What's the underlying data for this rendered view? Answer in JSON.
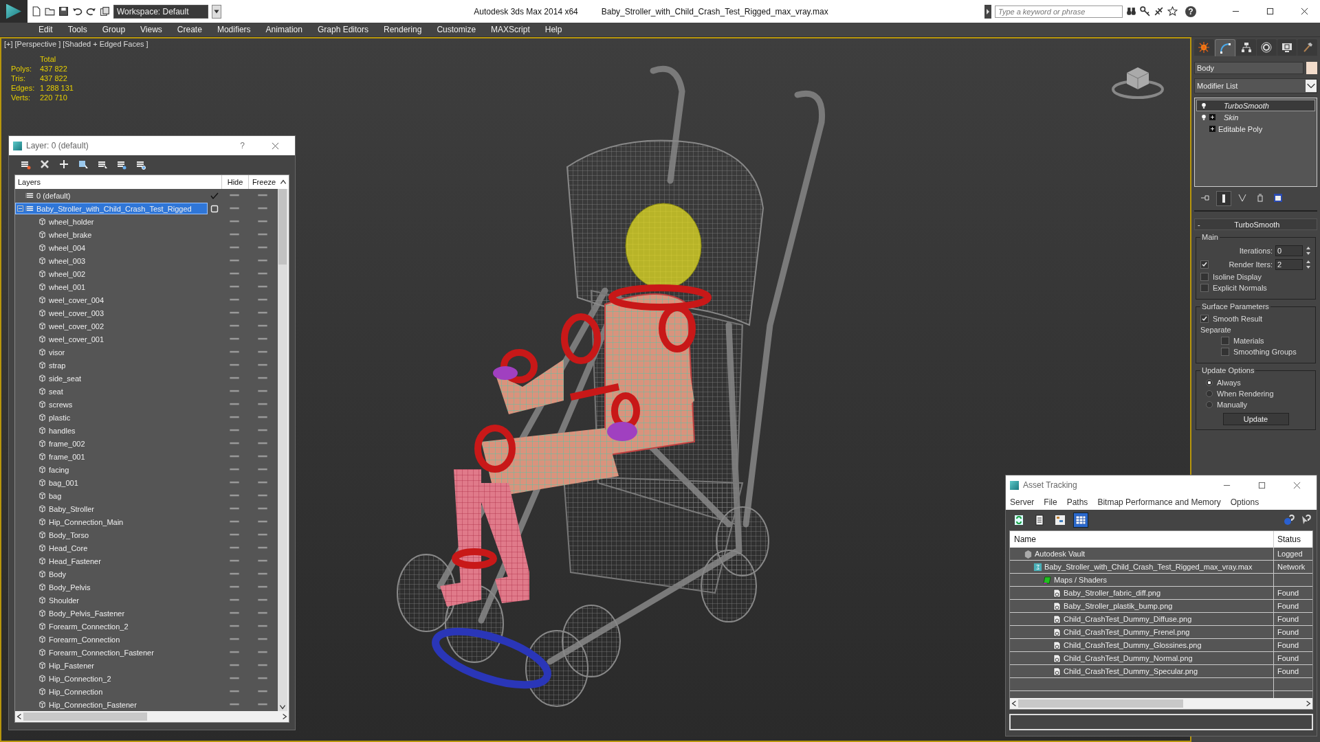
{
  "title_bar": {
    "workspace": "Workspace: Default",
    "app_title": "Autodesk 3ds Max  2014 x64",
    "file_name": "Baby_Stroller_with_Child_Crash_Test_Rigged_max_vray.max",
    "search": {
      "placeholder": "Type a keyword or phrase"
    },
    "help": "?"
  },
  "menu": [
    "Edit",
    "Tools",
    "Group",
    "Views",
    "Create",
    "Modifiers",
    "Animation",
    "Graph Editors",
    "Rendering",
    "Customize",
    "MAXScript",
    "Help"
  ],
  "viewport": {
    "labels": [
      "[+]",
      "[Perspective ]",
      "[Shaded + Edged Faces ]"
    ],
    "active": true,
    "stats": {
      "header": "Total",
      "rows": [
        {
          "label": "Polys:",
          "value": "437 822"
        },
        {
          "label": "Tris:",
          "value": "437 822"
        },
        {
          "label": "Edges:",
          "value": "1 288 131"
        },
        {
          "label": "Verts:",
          "value": "220 710"
        }
      ]
    }
  },
  "layer_dialog": {
    "title": "Layer: 0 (default)",
    "help": "?",
    "columns": [
      "Layers",
      "Hide",
      "Freeze"
    ],
    "tools": [
      {
        "kind": "new_layer"
      },
      {
        "kind": "delete"
      },
      {
        "kind": "add"
      },
      {
        "kind": "select_objects"
      },
      {
        "kind": "select_layer"
      },
      {
        "kind": "highlight"
      },
      {
        "kind": "settings"
      }
    ],
    "layers": [
      {
        "name": "0 (default)",
        "kind": "layer",
        "current": true,
        "selected": false,
        "hidden": false,
        "frozen": false
      },
      {
        "name": "Baby_Stroller_with_Child_Crash_Test_Rigged",
        "kind": "layer",
        "current": false,
        "selected": true,
        "expanded": true,
        "hidden": false,
        "frozen": false,
        "children": [
          {
            "name": "wheel_holder",
            "kind": "object",
            "selected": false,
            "hidden": false,
            "frozen": false
          },
          {
            "name": "wheel_brake",
            "kind": "object",
            "selected": false,
            "hidden": false,
            "frozen": false
          },
          {
            "name": "wheel_004",
            "kind": "object",
            "selected": false,
            "hidden": false,
            "frozen": false
          },
          {
            "name": "wheel_003",
            "kind": "object",
            "selected": false,
            "hidden": false,
            "frozen": false
          },
          {
            "name": "wheel_002",
            "kind": "object",
            "selected": false,
            "hidden": false,
            "frozen": false
          },
          {
            "name": "wheel_001",
            "kind": "object",
            "selected": false,
            "hidden": false,
            "frozen": false
          },
          {
            "name": "weel_cover_004",
            "kind": "object",
            "selected": false,
            "hidden": false,
            "frozen": false
          },
          {
            "name": "weel_cover_003",
            "kind": "object",
            "selected": false,
            "hidden": false,
            "frozen": false
          },
          {
            "name": "weel_cover_002",
            "kind": "object",
            "selected": false,
            "hidden": false,
            "frozen": false
          },
          {
            "name": "weel_cover_001",
            "kind": "object",
            "selected": false,
            "hidden": false,
            "frozen": false
          },
          {
            "name": "visor",
            "kind": "object",
            "selected": false,
            "hidden": false,
            "frozen": false
          },
          {
            "name": "strap",
            "kind": "object",
            "selected": false,
            "hidden": false,
            "frozen": false
          },
          {
            "name": "side_seat",
            "kind": "object",
            "selected": false,
            "hidden": false,
            "frozen": false
          },
          {
            "name": "seat",
            "kind": "object",
            "selected": false,
            "hidden": false,
            "frozen": false
          },
          {
            "name": "screws",
            "kind": "object",
            "selected": false,
            "hidden": false,
            "frozen": false
          },
          {
            "name": "plastic",
            "kind": "object",
            "selected": false,
            "hidden": false,
            "frozen": false
          },
          {
            "name": "handles",
            "kind": "object",
            "selected": false,
            "hidden": false,
            "frozen": false
          },
          {
            "name": "frame_002",
            "kind": "object",
            "selected": false,
            "hidden": false,
            "frozen": false
          },
          {
            "name": "frame_001",
            "kind": "object",
            "selected": false,
            "hidden": false,
            "frozen": false
          },
          {
            "name": "facing",
            "kind": "object",
            "selected": false,
            "hidden": false,
            "frozen": false
          },
          {
            "name": "bag_001",
            "kind": "object",
            "selected": false,
            "hidden": false,
            "frozen": false
          },
          {
            "name": "bag",
            "kind": "object",
            "selected": false,
            "hidden": false,
            "frozen": false
          },
          {
            "name": "Baby_Stroller",
            "kind": "object",
            "selected": false,
            "hidden": false,
            "frozen": false
          },
          {
            "name": "Hip_Connection_Main",
            "kind": "object",
            "selected": false,
            "hidden": false,
            "frozen": false
          },
          {
            "name": "Body_Torso",
            "kind": "object",
            "selected": false,
            "hidden": false,
            "frozen": false
          },
          {
            "name": "Head_Core",
            "kind": "object",
            "selected": false,
            "hidden": false,
            "frozen": false
          },
          {
            "name": "Head_Fastener",
            "kind": "object",
            "selected": false,
            "hidden": false,
            "frozen": false
          },
          {
            "name": "Body",
            "kind": "object",
            "selected": false,
            "hidden": false,
            "frozen": false
          },
          {
            "name": "Body_Pelvis",
            "kind": "object",
            "selected": false,
            "hidden": false,
            "frozen": false
          },
          {
            "name": "Shoulder",
            "kind": "object",
            "selected": false,
            "hidden": false,
            "frozen": false
          },
          {
            "name": "Body_Pelvis_Fastener",
            "kind": "object",
            "selected": false,
            "hidden": false,
            "frozen": false
          },
          {
            "name": "Forearm_Connection_2",
            "kind": "object",
            "selected": false,
            "hidden": false,
            "frozen": false
          },
          {
            "name": "Forearm_Connection",
            "kind": "object",
            "selected": false,
            "hidden": false,
            "frozen": false
          },
          {
            "name": "Forearm_Connection_Fastener",
            "kind": "object",
            "selected": false,
            "hidden": false,
            "frozen": false
          },
          {
            "name": "Hip_Fastener",
            "kind": "object",
            "selected": false,
            "hidden": false,
            "frozen": false
          },
          {
            "name": "Hip_Connection_2",
            "kind": "object",
            "selected": false,
            "hidden": false,
            "frozen": false
          },
          {
            "name": "Hip_Connection",
            "kind": "object",
            "selected": false,
            "hidden": false,
            "frozen": false
          },
          {
            "name": "Hip_Connection_Fastener",
            "kind": "object",
            "selected": false,
            "hidden": false,
            "frozen": false
          }
        ]
      }
    ]
  },
  "command_panel": {
    "tabs": [
      {
        "kind": "create",
        "selected": false
      },
      {
        "kind": "modify",
        "selected": true
      },
      {
        "kind": "hierarchy",
        "selected": false
      },
      {
        "kind": "motion",
        "selected": false
      },
      {
        "kind": "display",
        "selected": false
      },
      {
        "kind": "utilities",
        "selected": false
      }
    ],
    "object_name": "Body",
    "modifier_list": "Modifier List",
    "stack": [
      {
        "name": "TurboSmooth",
        "kind": "modifier",
        "expandable": false,
        "selected": true
      },
      {
        "name": "Skin",
        "kind": "modifier",
        "expandable": true,
        "selected": false
      },
      {
        "name": "Editable Poly",
        "kind": "base",
        "expandable": true,
        "selected": false
      }
    ],
    "stack_tools": [
      {
        "kind": "pin",
        "on": false
      },
      {
        "kind": "end_result",
        "on": true
      },
      {
        "kind": "unique",
        "on": false
      },
      {
        "kind": "remove",
        "on": false
      },
      {
        "kind": "configure",
        "on": false
      }
    ],
    "turbosmooth": {
      "title": "TurboSmooth",
      "toggle": "-",
      "main": {
        "title": "Main",
        "iterations": {
          "label": "Iterations:",
          "value": "0"
        },
        "render_iters": {
          "label": "Render Iters:",
          "value": "2",
          "checked": true
        },
        "checks": [
          {
            "label": "Isoline Display",
            "checked": false
          },
          {
            "label": "Explicit Normals",
            "checked": false
          }
        ]
      },
      "surface": {
        "title": "Surface Parameters",
        "smooth_result": {
          "label": "Smooth Result",
          "checked": true
        },
        "separate": "Separate",
        "checks": [
          {
            "label": "Materials",
            "checked": false
          },
          {
            "label": "Smoothing Groups",
            "checked": false
          }
        ]
      },
      "update": {
        "title": "Update Options",
        "options": [
          {
            "label": "Always",
            "selected": true
          },
          {
            "label": "When Rendering",
            "selected": false
          },
          {
            "label": "Manually",
            "selected": false
          }
        ],
        "button": "Update"
      }
    }
  },
  "asset_tracking": {
    "title": "Asset Tracking",
    "menu": [
      "Server",
      "File",
      "Paths",
      "Bitmap Performance and Memory",
      "Options"
    ],
    "tools": [
      {
        "kind": "refresh",
        "selected": false
      },
      {
        "kind": "list",
        "selected": false
      },
      {
        "kind": "tree",
        "selected": false
      },
      {
        "kind": "table",
        "selected": true
      }
    ],
    "columns": [
      "Name",
      "Status"
    ],
    "rows": [
      {
        "name": "Autodesk Vault",
        "kind": "vault",
        "status": "Logged",
        "children": [
          {
            "name": "Baby_Stroller_with_Child_Crash_Test_Rigged_max_vray.max",
            "kind": "scene",
            "status": "Network",
            "children": [
              {
                "name": "Maps / Shaders",
                "kind": "folder",
                "children": [
                  {
                    "name": "Baby_Stroller_fabric_diff.png",
                    "kind": "bitmap",
                    "status": "Found"
                  },
                  {
                    "name": "Baby_Stroller_plastik_bump.png",
                    "kind": "bitmap",
                    "status": "Found"
                  },
                  {
                    "name": "Child_CrashTest_Dummy_Diffuse.png",
                    "kind": "bitmap",
                    "status": "Found"
                  },
                  {
                    "name": "Child_CrashTest_Dummy_Frenel.png",
                    "kind": "bitmap",
                    "status": "Found"
                  },
                  {
                    "name": "Child_CrashTest_Dummy_Glossines.png",
                    "kind": "bitmap",
                    "status": "Found"
                  },
                  {
                    "name": "Child_CrashTest_Dummy_Normal.png",
                    "kind": "bitmap",
                    "status": "Found"
                  },
                  {
                    "name": "Child_CrashTest_Dummy_Specular.png",
                    "kind": "bitmap",
                    "status": "Found"
                  }
                ]
              }
            ]
          }
        ]
      }
    ]
  }
}
